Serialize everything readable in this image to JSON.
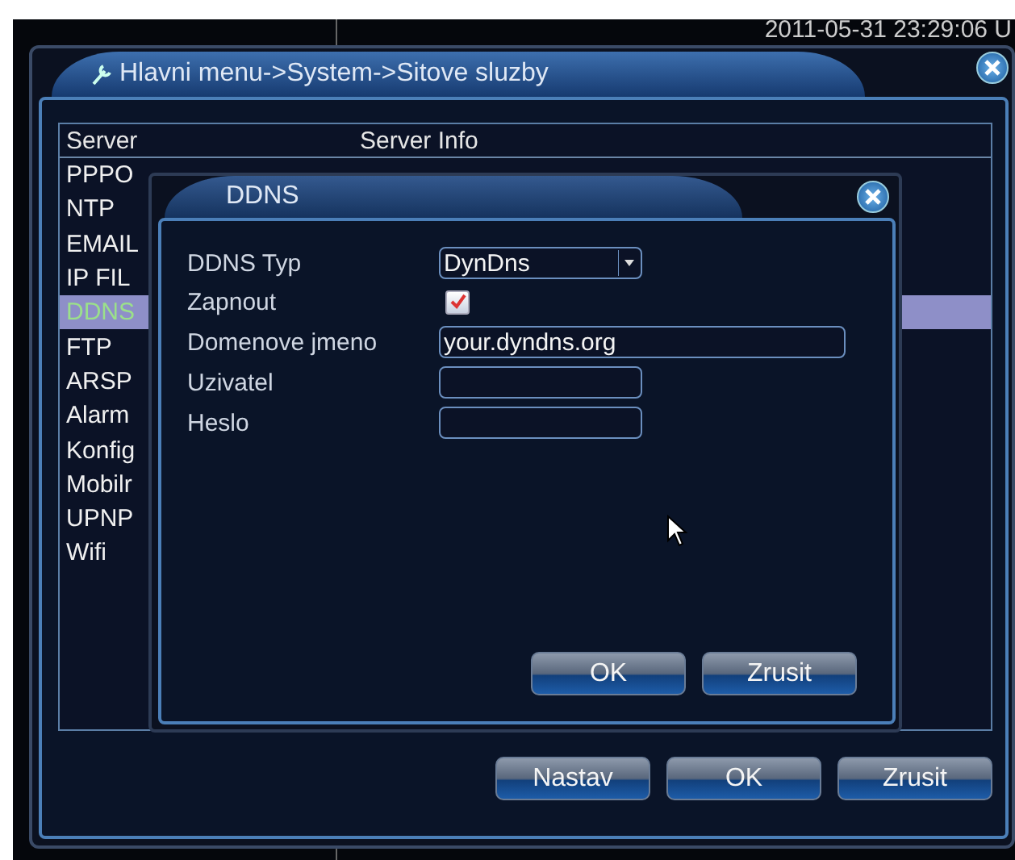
{
  "timestamp": "2011-05-31 23:29:06 U",
  "window": {
    "title": "Hlavni menu->System->Sitove sluzby"
  },
  "table": {
    "columns": [
      "Server",
      "Server Info"
    ],
    "rows": [
      {
        "label": "PPPO",
        "selected": false
      },
      {
        "label": "NTP",
        "selected": false
      },
      {
        "label": "EMAIL",
        "selected": false
      },
      {
        "label": "IP FIL",
        "selected": false
      },
      {
        "label": "DDNS",
        "selected": true
      },
      {
        "label": "FTP",
        "selected": false
      },
      {
        "label": "ARSP",
        "selected": false
      },
      {
        "label": "Alarm",
        "selected": false
      },
      {
        "label": "Konfig",
        "selected": false
      },
      {
        "label": "Mobilr",
        "selected": false
      },
      {
        "label": "UPNP",
        "selected": false
      },
      {
        "label": "Wifi",
        "selected": false
      }
    ]
  },
  "buttons": [
    "Nastav",
    "OK",
    "Zrusit"
  ],
  "dialog": {
    "title": "DDNS",
    "fields": [
      {
        "label": "DDNS Typ",
        "kind": "select",
        "value": "DynDns"
      },
      {
        "label": "Zapnout",
        "kind": "checkbox",
        "checked": true
      },
      {
        "label": "Domenove jmeno",
        "kind": "text",
        "value": "your.dyndns.org",
        "wide": true
      },
      {
        "label": "Uzivatel",
        "kind": "text"
      },
      {
        "label": "Heslo",
        "kind": "text"
      }
    ],
    "buttons": [
      "OK",
      "Zrusit"
    ]
  }
}
